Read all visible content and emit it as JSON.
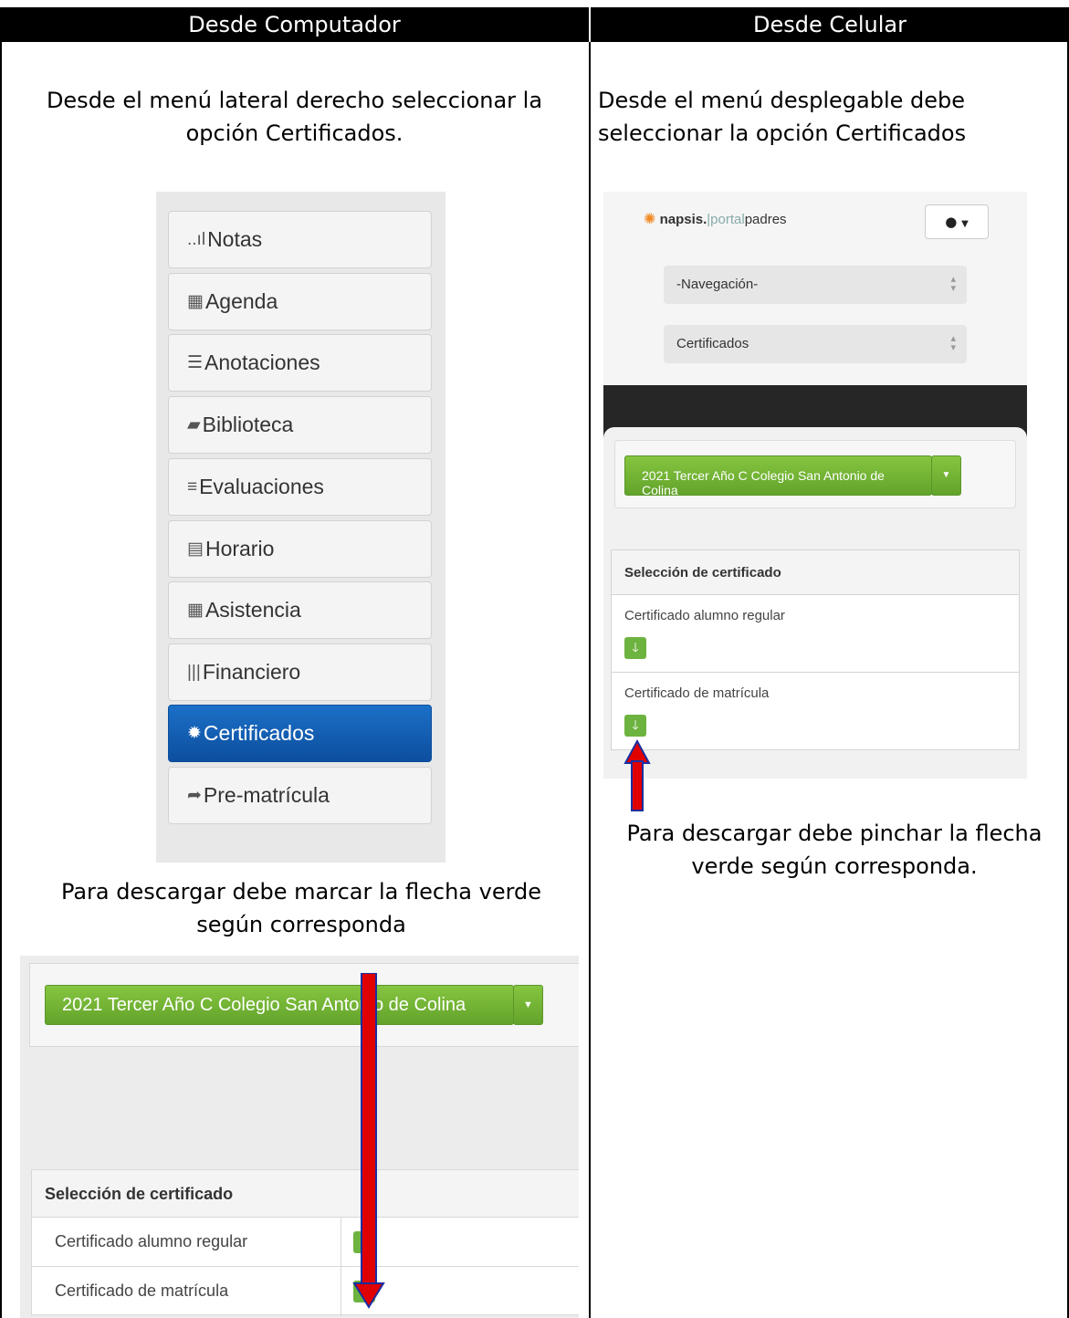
{
  "header": {
    "left": "Desde Computador",
    "right": "Desde Celular"
  },
  "left": {
    "instruction1": "Desde el menú lateral derecho seleccionar la opción Certificados.",
    "instruction2": "Para descargar debe marcar la flecha verde según corresponda",
    "menu": [
      {
        "icon": "signal-bars-icon",
        "glyph": "..ıl",
        "label": "Notas"
      },
      {
        "icon": "grid-icon",
        "glyph": "▦",
        "label": "Agenda"
      },
      {
        "icon": "list-icon",
        "glyph": "☰",
        "label": "Anotaciones"
      },
      {
        "icon": "book-icon",
        "glyph": "▰",
        "label": "Biblioteca"
      },
      {
        "icon": "list-lines-icon",
        "glyph": "≡",
        "label": "Evaluaciones"
      },
      {
        "icon": "schedule-icon",
        "glyph": "▤",
        "label": "Horario"
      },
      {
        "icon": "calendar-icon",
        "glyph": "▦",
        "label": "Asistencia"
      },
      {
        "icon": "barcode-icon",
        "glyph": "|||",
        "label": "Financiero"
      },
      {
        "icon": "certificate-icon",
        "glyph": "✹",
        "label": "Certificados",
        "active": true
      },
      {
        "icon": "share-arrow-icon",
        "glyph": "➦",
        "label": "Pre-matrícula"
      }
    ],
    "course_button": "2021 Tercer Año C Colegio San Antonio de Colina",
    "table_header": "Selección de certificado",
    "rows": [
      "Certificado alumno regular",
      "Certificado de matrícula"
    ]
  },
  "right": {
    "instruction1": "Desde el menú desplegable debe seleccionar la opción Certificados",
    "instruction2": "Para descargar debe pinchar la flecha verde según corresponda.",
    "logo": {
      "brand": "napsis.",
      "portal": "|portal",
      "padres": "padres"
    },
    "select_nav": "-Navegación-",
    "select_cert": "Certificados",
    "course_button": "2021 Tercer Año C Colegio San Antonio de Colina",
    "table_header": "Selección de certificado",
    "rows": [
      "Certificado alumno regular",
      "Certificado de matrícula"
    ]
  },
  "colors": {
    "accent_blue": "#0d4e9e",
    "green": "#6db33f",
    "arrow_red": "#e00000",
    "arrow_border": "#1a2fa0"
  }
}
